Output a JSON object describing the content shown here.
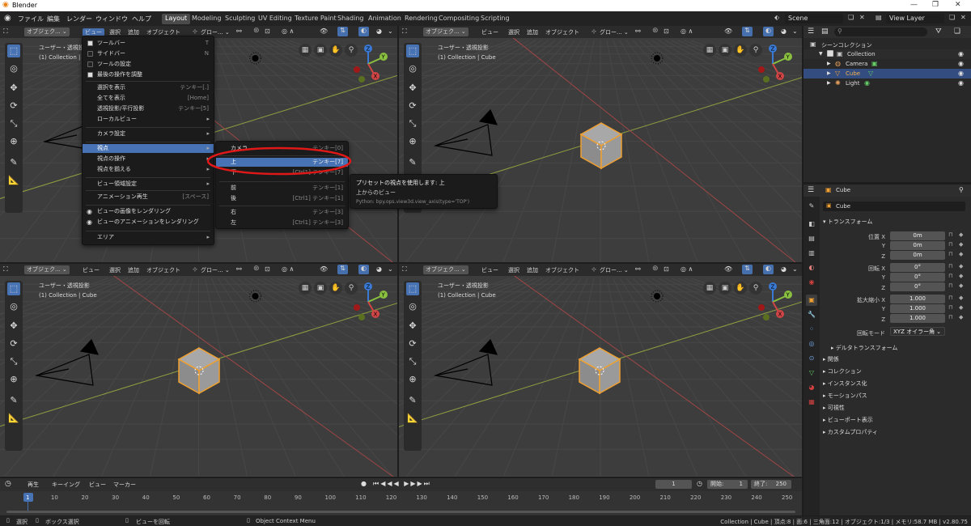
{
  "app": {
    "title": "Blender"
  },
  "menubar": {
    "items": [
      "ファイル",
      "編集",
      "レンダー",
      "ウィンドウ",
      "ヘルプ"
    ],
    "workspaces": [
      "Layout",
      "Modeling",
      "Sculpting",
      "UV Editing",
      "Texture Paint",
      "Shading",
      "Animation",
      "Rendering",
      "Compositing",
      "Scripting"
    ],
    "scene_label": "Scene",
    "view_layer_label": "View Layer"
  },
  "viewport_header": {
    "mode": "オブジェク...",
    "menus": [
      "ビュー",
      "選択",
      "追加",
      "オブジェクト"
    ],
    "orientation": "グロー..."
  },
  "viewports": [
    {
      "view_name": "ユーザー・透視投影",
      "collection": "(1) Collection | C"
    },
    {
      "view_name": "ユーザー・透視投影",
      "collection": "(1) Collection | Cube"
    },
    {
      "view_name": "ユーザー・透視投影",
      "collection": "(1) Collection | Cube"
    },
    {
      "view_name": "ユーザー・透視投影",
      "collection": "(1) Collection | Cube"
    }
  ],
  "view_menu": {
    "items": [
      {
        "label": "ツールバー",
        "shortcut": "T",
        "check": true
      },
      {
        "label": "サイドバー",
        "shortcut": "N",
        "check": false
      },
      {
        "label": "ツールの設定",
        "shortcut": "",
        "check": false
      },
      {
        "label": "最後の操作を調整",
        "shortcut": "",
        "check": true
      },
      {
        "label": "選択を表示",
        "shortcut": "テンキー[.]"
      },
      {
        "label": "全てを表示",
        "shortcut": "[Home]"
      },
      {
        "label": "透視投影/平行投影",
        "shortcut": "テンキー[5]"
      },
      {
        "label": "ローカルビュー",
        "shortcut": "▸"
      },
      {
        "label": "カメラ設定",
        "shortcut": "▸"
      },
      {
        "label": "視点",
        "shortcut": "▸"
      },
      {
        "label": "視点の操作",
        "shortcut": "▸"
      },
      {
        "label": "視点を揃える",
        "shortcut": "▸"
      },
      {
        "label": "ビュー領域設定",
        "shortcut": "▸"
      },
      {
        "label": "アニメーション再生",
        "shortcut": "[スペース]"
      },
      {
        "label": "ビューの画像をレンダリング",
        "shortcut": ""
      },
      {
        "label": "ビューのアニメーションをレンダリング",
        "shortcut": ""
      },
      {
        "label": "エリア",
        "shortcut": "▸"
      }
    ]
  },
  "viewpoint_submenu": {
    "items": [
      {
        "label": "カメラ",
        "shortcut": "テンキー[0]"
      },
      {
        "label": "上",
        "shortcut": "テンキー[7]"
      },
      {
        "label": "下",
        "shortcut": "[Ctrl1] テンキー[7]"
      },
      {
        "label": "前",
        "shortcut": "テンキー[1]"
      },
      {
        "label": "後",
        "shortcut": "[Ctrl1] テンキー[1]"
      },
      {
        "label": "右",
        "shortcut": "テンキー[3]"
      },
      {
        "label": "左",
        "shortcut": "[Ctrl1] テンキー[3]"
      }
    ]
  },
  "tooltip": {
    "title": "プリセットの視点を使用します: 上",
    "desc": "上からのビュー",
    "python": "Python: bpy.ops.view3d.view_axis(type='TOP')"
  },
  "outliner": {
    "root": "シーンコレクション",
    "collection": "Collection",
    "objects": [
      "Camera",
      "Cube",
      "Light"
    ]
  },
  "properties": {
    "object_name": "Cube",
    "data_name": "Cube",
    "transform_title": "トランスフォーム",
    "location_label": "位置 X",
    "rotation_label": "回転 X",
    "scale_label": "拡大縮小 X",
    "axis_y": "Y",
    "axis_z": "Z",
    "location": [
      "0m",
      "0m",
      "0m"
    ],
    "rotation": [
      "0°",
      "0°",
      "0°"
    ],
    "scale": [
      "1.000",
      "1.000",
      "1.000"
    ],
    "rotation_mode_label": "回転モード",
    "rotation_mode": "XYZ オイラー角",
    "delta": "デルタトランスフォーム",
    "sections": [
      "関係",
      "コレクション",
      "インスタンス化",
      "モーションパス",
      "可視性",
      "ビューポート表示",
      "カスタムプロパティ"
    ]
  },
  "timeline": {
    "menus": [
      "再生",
      "キーイング",
      "ビュー",
      "マーカー"
    ],
    "current_frame": "1",
    "start_label": "開始:",
    "start": "1",
    "end_label": "終了:",
    "end": "250",
    "ticks": [
      "1",
      "10",
      "20",
      "30",
      "40",
      "50",
      "60",
      "70",
      "80",
      "90",
      "100",
      "110",
      "120",
      "130",
      "140",
      "150",
      "160",
      "170",
      "180",
      "190",
      "200",
      "210",
      "220",
      "230",
      "240",
      "250"
    ]
  },
  "statusbar": {
    "select": "選択",
    "box_select": "ボックス選択",
    "rotate_view": "ビューを回転",
    "context_menu": "Object Context Menu",
    "stats": "Collection | Cube | 頂点:8 | 面:6 | 三角面:12 | オブジェクト:1/3 | メモリ:58.7 MB | v2.80.75"
  },
  "colors": {
    "accent": "#4772b3",
    "grid_x": "#a04545",
    "grid_y": "#8fa040",
    "annotation": "#e01818",
    "cube_edge": "#f0a030"
  }
}
